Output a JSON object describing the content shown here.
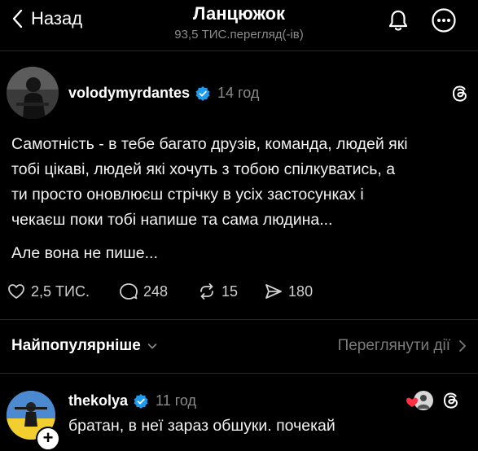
{
  "header": {
    "back_label": "Назад",
    "title": "Ланцюжок",
    "views": "93,5 ТИС.перегляд(-ів)"
  },
  "post": {
    "username": "volodymyrdantes",
    "time": "14 год",
    "text": "Самотність - в тебе багато друзів, команда, людей які\nтобі цікаві, людей які хочуть з тобою спілкуватись, а\nти просто оновлюєш стрічку в усіх застосунках і\nчекаєш поки тобі напише та сама людина...",
    "text2": "Але вона не пише...",
    "likes": "2,5 ТИС.",
    "replies": "248",
    "reposts": "15",
    "shares": "180"
  },
  "sort": {
    "label": "Найпопулярніше",
    "view_activity": "Переглянути дії"
  },
  "reply": {
    "username": "thekolya",
    "time": "11 год",
    "text": "братан, в неї зараз обшуки. почекай"
  },
  "colors": {
    "background": "#000000",
    "verified": "#1d9bf0",
    "muted": "#8a8a8a"
  }
}
